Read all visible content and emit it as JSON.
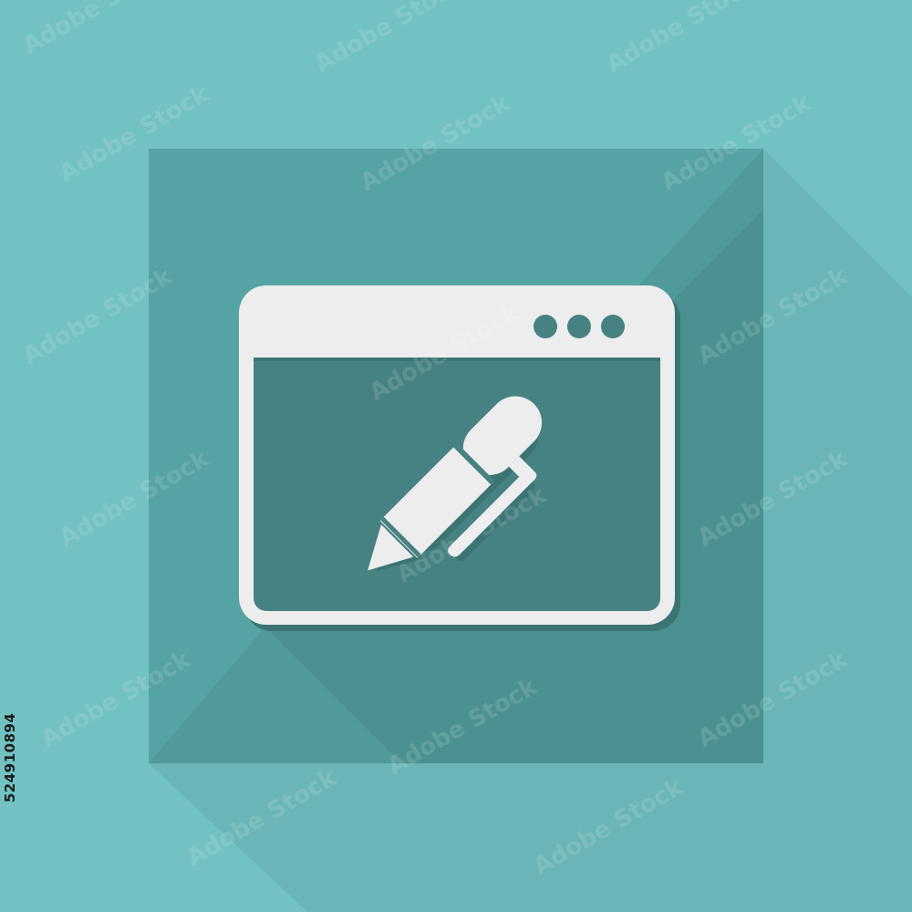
{
  "colors": {
    "background": "#72c2c2",
    "tile": "#55a3a3",
    "tile_shadow": "#4b8f8f",
    "window_fill": "#478282",
    "white": "#ededed",
    "icon_shadow": "#3c7474"
  },
  "icons": {
    "main": "browser-window-with-pen-icon",
    "window_dots": "three-dots-icon",
    "pen": "pen-icon"
  },
  "watermark": {
    "text": "Adobe Stock"
  },
  "stock_id": "524910894"
}
